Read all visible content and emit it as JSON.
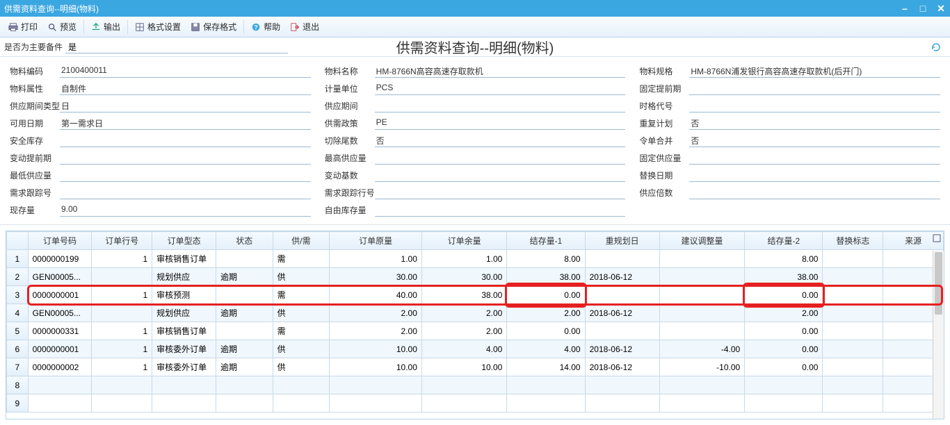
{
  "window": {
    "title": "供需资料查询--明细(物料)"
  },
  "toolbar": {
    "print": "打印",
    "preview": "预览",
    "export": "输出",
    "format": "格式设置",
    "saveformat": "保存格式",
    "help": "帮助",
    "exit": "退出"
  },
  "filter": {
    "label": "是否为主要备件",
    "value": "是"
  },
  "pagetitle": "供需资料查询--明细(物料)",
  "info": {
    "col1": [
      {
        "label": "物料编码",
        "value": "2100400011"
      },
      {
        "label": "物料属性",
        "value": "自制件"
      },
      {
        "label": "供应期间类型",
        "value": "日"
      },
      {
        "label": "可用日期",
        "value": "第一需求日"
      },
      {
        "label": "安全库存",
        "value": ""
      },
      {
        "label": "变动提前期",
        "value": ""
      },
      {
        "label": "最低供应量",
        "value": ""
      },
      {
        "label": "需求跟踪号",
        "value": ""
      },
      {
        "label": "现存量",
        "value": "9.00"
      }
    ],
    "col2": [
      {
        "label": "物料名称",
        "value": "HM-8766N高容高速存取款机"
      },
      {
        "label": "计量单位",
        "value": "PCS"
      },
      {
        "label": "供应期间",
        "value": ""
      },
      {
        "label": "供需政策",
        "value": "PE"
      },
      {
        "label": "切除尾数",
        "value": "否"
      },
      {
        "label": "最高供应量",
        "value": ""
      },
      {
        "label": "变动基数",
        "value": ""
      },
      {
        "label": "需求跟踪行号",
        "value": ""
      },
      {
        "label": "自由库存量",
        "value": ""
      }
    ],
    "col3": [
      {
        "label": "物料规格",
        "value": "HM-8766N浦发银行高容高速存取款机(后开门)"
      },
      {
        "label": "固定提前期",
        "value": ""
      },
      {
        "label": "时格代号",
        "value": ""
      },
      {
        "label": "重复计划",
        "value": "否"
      },
      {
        "label": "令单合并",
        "value": "否"
      },
      {
        "label": "固定供应量",
        "value": ""
      },
      {
        "label": "替换日期",
        "value": ""
      },
      {
        "label": "供应倍数",
        "value": ""
      }
    ]
  },
  "table": {
    "headers": [
      "",
      "订单号码",
      "订单行号",
      "订单型态",
      "状态",
      "供/需",
      "订单原量",
      "订单余量",
      "结存量-1",
      "重规划日",
      "建议调整量",
      "结存量-2",
      "替换标志",
      "来源"
    ],
    "rows": [
      {
        "idx": "1",
        "orderno": "0000000199",
        "line": "1",
        "type": "审核销售订单",
        "status": "",
        "sd": "需",
        "origqty": "1.00",
        "remqty": "1.00",
        "bal1": "8.00",
        "replan": "",
        "adj": "",
        "bal2": "8.00",
        "repflag": "",
        "src": ""
      },
      {
        "idx": "2",
        "orderno": "GEN00005...",
        "line": "",
        "type": "规划供应",
        "status": "逾期",
        "sd": "供",
        "origqty": "30.00",
        "remqty": "30.00",
        "bal1": "38.00",
        "replan": "2018-06-12",
        "adj": "",
        "bal2": "38.00",
        "repflag": "",
        "src": ""
      },
      {
        "idx": "3",
        "orderno": "0000000001",
        "line": "1",
        "type": "审核预测",
        "status": "",
        "sd": "需",
        "origqty": "40.00",
        "remqty": "38.00",
        "bal1": "0.00",
        "replan": "",
        "adj": "",
        "bal2": "0.00",
        "repflag": "",
        "src": "",
        "highlight": true
      },
      {
        "idx": "4",
        "orderno": "GEN00005...",
        "line": "",
        "type": "规划供应",
        "status": "逾期",
        "sd": "供",
        "origqty": "2.00",
        "remqty": "2.00",
        "bal1": "2.00",
        "replan": "2018-06-12",
        "adj": "",
        "bal2": "2.00",
        "repflag": "",
        "src": ""
      },
      {
        "idx": "5",
        "orderno": "0000000331",
        "line": "1",
        "type": "审核销售订单",
        "status": "",
        "sd": "需",
        "origqty": "2.00",
        "remqty": "2.00",
        "bal1": "0.00",
        "replan": "",
        "adj": "",
        "bal2": "0.00",
        "repflag": "",
        "src": ""
      },
      {
        "idx": "6",
        "orderno": "0000000001",
        "line": "1",
        "type": "审核委外订单",
        "status": "逾期",
        "sd": "供",
        "origqty": "10.00",
        "remqty": "4.00",
        "bal1": "4.00",
        "replan": "2018-06-12",
        "adj": "-4.00",
        "bal2": "0.00",
        "repflag": "",
        "src": ""
      },
      {
        "idx": "7",
        "orderno": "0000000002",
        "line": "1",
        "type": "审核委外订单",
        "status": "逾期",
        "sd": "供",
        "origqty": "10.00",
        "remqty": "10.00",
        "bal1": "14.00",
        "replan": "2018-06-12",
        "adj": "-10.00",
        "bal2": "0.00",
        "repflag": "",
        "src": ""
      },
      {
        "idx": "8",
        "orderno": "",
        "line": "",
        "type": "",
        "status": "",
        "sd": "",
        "origqty": "",
        "remqty": "",
        "bal1": "",
        "replan": "",
        "adj": "",
        "bal2": "",
        "repflag": "",
        "src": ""
      },
      {
        "idx": "9",
        "orderno": "",
        "line": "",
        "type": "",
        "status": "",
        "sd": "",
        "origqty": "",
        "remqty": "",
        "bal1": "",
        "replan": "",
        "adj": "",
        "bal2": "",
        "repflag": "",
        "src": ""
      }
    ]
  }
}
